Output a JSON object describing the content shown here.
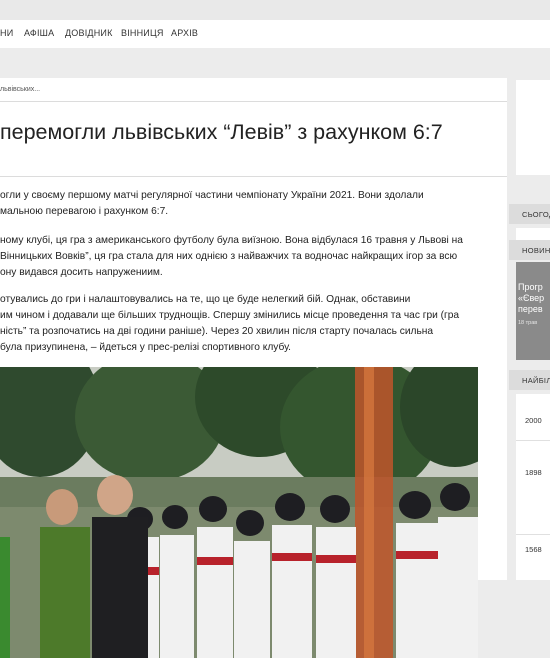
{
  "nav": {
    "items": [
      "НИ",
      "АФІША",
      "ДОВІДНИК",
      "ВІННИЦЯ",
      "АРХІВ"
    ]
  },
  "breadcrumb": "львівських...",
  "article": {
    "title": "перемогли львівських “Левів” з рахунком 6:7",
    "paragraphs": [
      [
        "огли у своєму першому матчі регулярної частини чемпіонату України 2021. Вони здолали",
        "мальною перевагою і рахунком 6:7."
      ],
      [
        "ному клубі, ця гра з американського футболу була виїзною. Вона відбулася 16 травня у Львові на",
        "Вінницьких Вовків”, ця гра стала для них однією з найважчих та водночас найкращих ігор за всю",
        "ону видався досить напружениим."
      ],
      [
        "отувались до гри і налаштовувались на те, що це буде нелегкий бій. Однак, обставини",
        "им чином і додавали ще більших труднощів. Спершу змінились місце проведення та час гри (гра",
        "ність” та розпочатись на дві години раніше). Через 20 хвилин після старту почалась сильна",
        "була призупинена, – йдеться у прес-релізі спортивного клубу."
      ]
    ]
  },
  "sidebar": {
    "tab_today": "СЬОГОД",
    "tab_news": "НОВИН",
    "news_lines": [
      "Прогр",
      "«Євер",
      "перев"
    ],
    "news_meta": "18 трав",
    "tab_most": "НАЙБІЛ",
    "numbers": [
      "2000",
      "1898",
      "1568"
    ]
  }
}
